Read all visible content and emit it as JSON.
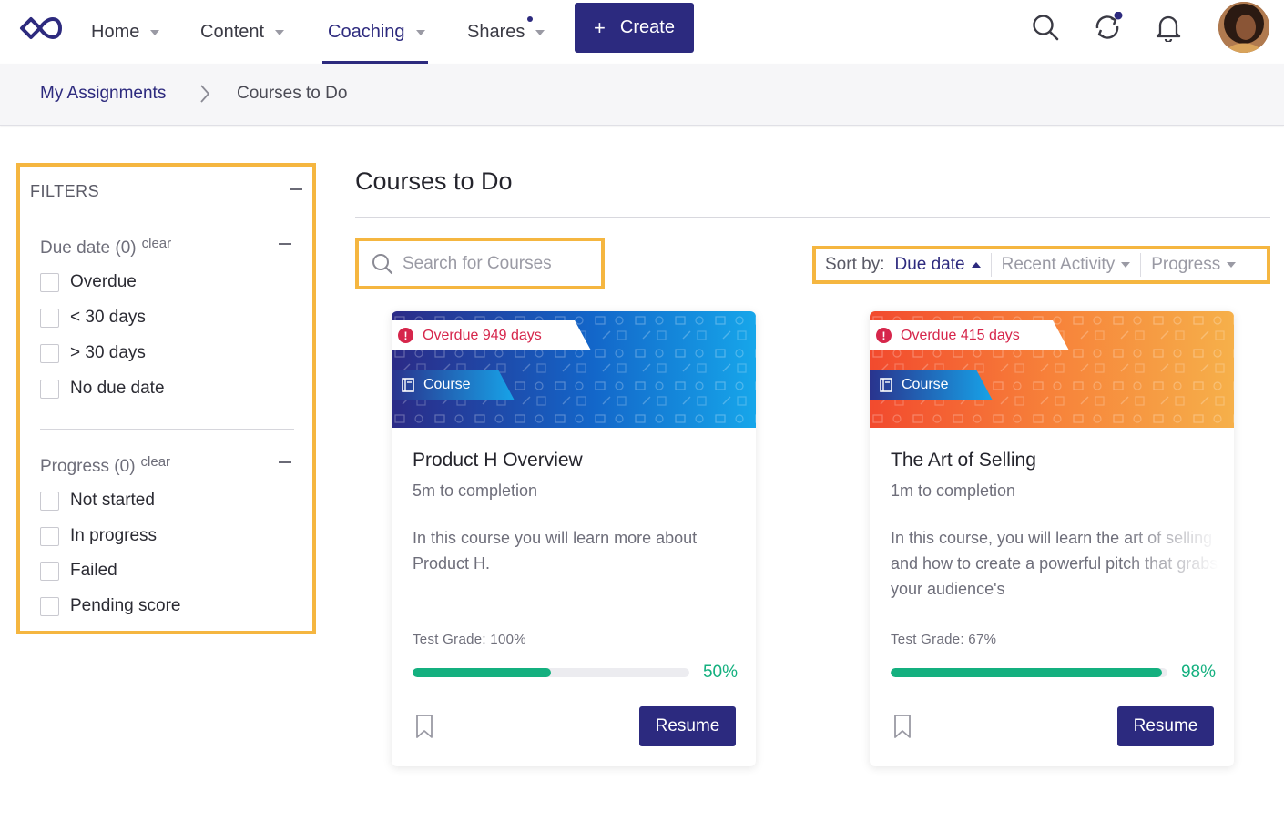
{
  "nav": {
    "items": [
      {
        "label": "Home"
      },
      {
        "label": "Content"
      },
      {
        "label": "Coaching"
      },
      {
        "label": "Shares"
      }
    ],
    "active": "Coaching",
    "create_label": "Create"
  },
  "breadcrumb": {
    "parent": "My Assignments",
    "current": "Courses to Do"
  },
  "filters": {
    "title": "FILTERS",
    "due_date": {
      "title": "Due date (0)",
      "clear": "clear",
      "options": [
        "Overdue",
        "< 30 days",
        "> 30 days",
        "No due date"
      ]
    },
    "progress": {
      "title": "Progress (0)",
      "clear": "clear",
      "options": [
        "Not started",
        "In progress",
        "Failed",
        "Pending score"
      ]
    }
  },
  "main": {
    "title": "Courses to Do",
    "search_placeholder": "Search for Courses",
    "sort": {
      "label": "Sort by:",
      "active": "Due date",
      "options": [
        "Recent Activity",
        "Progress"
      ]
    }
  },
  "cards": [
    {
      "overdue": "Overdue 949 days",
      "type": "Course",
      "title": "Product H Overview",
      "time": "5m to completion",
      "description": "In this course you will learn more about Product H.",
      "grade": "Test Grade: 100%",
      "progress_pct": 50,
      "progress_label": "50%",
      "action": "Resume",
      "theme": "blue"
    },
    {
      "overdue": "Overdue 415 days",
      "type": "Course",
      "title": "The Art of Selling",
      "time": "1m to completion",
      "description": "In this course, you will learn the art of selling and how to create a powerful pitch that grabs your audience's",
      "grade": "Test Grade: 67%",
      "progress_pct": 98,
      "progress_label": "98%",
      "action": "Resume",
      "theme": "orange"
    }
  ],
  "colors": {
    "brand": "#2c2a7f",
    "highlight": "#f5b640",
    "overdue": "#d6264b",
    "progress": "#14b07f"
  }
}
